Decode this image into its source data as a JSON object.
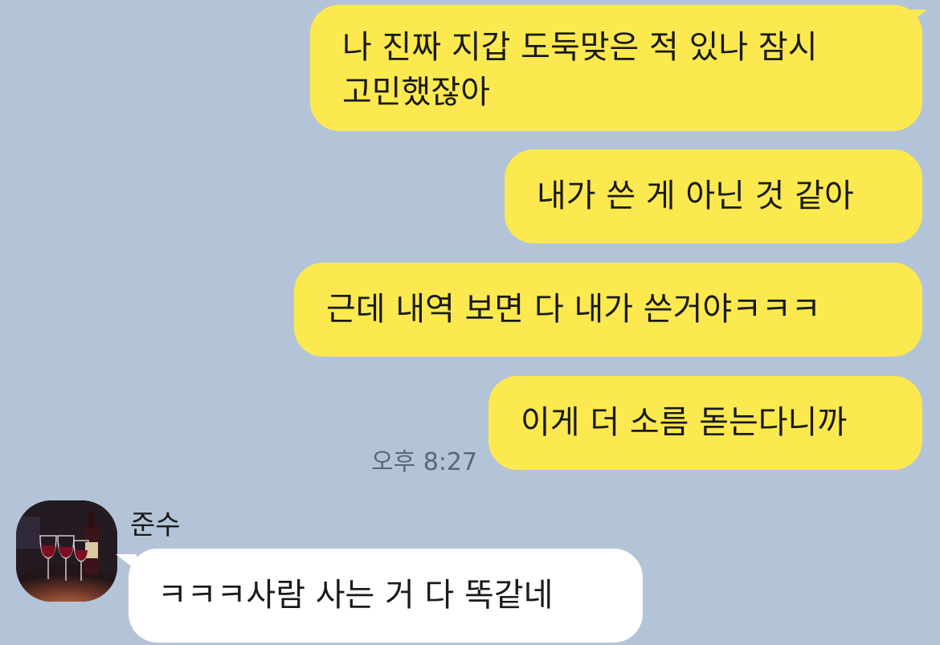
{
  "messages": {
    "sent": [
      {
        "lines": [
          "나 진짜 지갑 도둑맞은 적 있나 잠시",
          "고민했잖아"
        ]
      },
      {
        "lines": [
          "내가 쓴 게 아닌 것 같아"
        ]
      },
      {
        "lines": [
          "근데 내역 보면 다 내가 쓴거야ㅋㅋㅋ"
        ]
      },
      {
        "lines": [
          "이게 더 소름 돋는다니까"
        ]
      }
    ],
    "sent_time": "오후 8:27",
    "received": {
      "sender": "준수",
      "text": "ㅋㅋㅋ사람 사는 거 다 똑같네"
    }
  },
  "colors": {
    "background": "#b4c4d8",
    "sent_bubble": "#fbe94f",
    "received_bubble": "#ffffff"
  },
  "icons": {
    "avatar": "wine-glasses-photo"
  }
}
